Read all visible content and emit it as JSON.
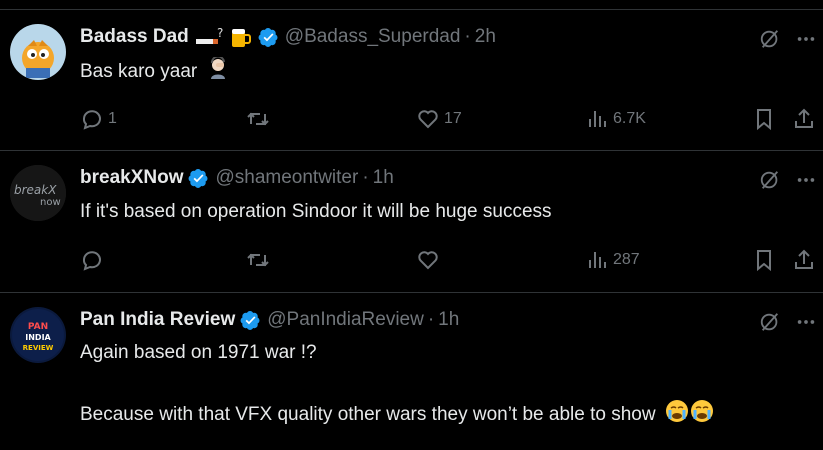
{
  "tweets": [
    {
      "name": "Badass Dad",
      "handle": "@Badass_Superdad",
      "separator": "·",
      "time": "2h",
      "text": "Bas karo yaar",
      "stats": {
        "replies": "1",
        "retweets": "",
        "likes": "17",
        "views": "6.7K"
      }
    },
    {
      "name": "breakXNow",
      "handle": "@shameontwiter",
      "separator": "·",
      "time": "1h",
      "text": "If it's based on operation Sindoor it will be huge success",
      "avatar_text": {
        "line1": "breakX",
        "line2": "now"
      },
      "stats": {
        "replies": "",
        "retweets": "",
        "likes": "",
        "views": "287"
      }
    },
    {
      "name": "Pan India Review",
      "handle": "@PanIndiaReview",
      "separator": "·",
      "time": "1h",
      "text_line1": "Again based on 1971 war !?",
      "text_line2": "Because with that VFX quality other wars they won’t be able to show",
      "avatar_text": {
        "line1": "PAN",
        "line2": "INDIA",
        "line3": "REVIEW"
      },
      "stats": {
        "replies": "",
        "retweets": "",
        "likes": "",
        "views": ""
      }
    }
  ],
  "colors": {
    "background": "#000000",
    "text": "#e7e9ea",
    "muted": "#71767b",
    "border": "#2f3336",
    "verified": "#1d9bf0"
  },
  "icons": [
    "grok-icon",
    "more-icon",
    "reply-icon",
    "retweet-icon",
    "like-icon",
    "views-icon",
    "bookmark-icon",
    "share-icon",
    "verified-icon"
  ]
}
